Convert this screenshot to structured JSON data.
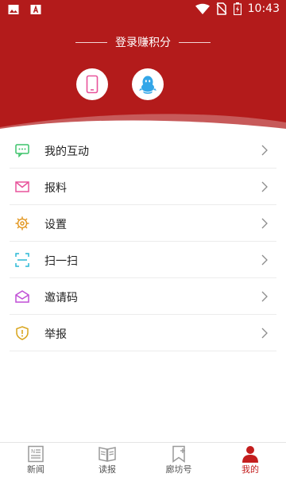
{
  "status_bar": {
    "time": "10:43",
    "icons": [
      "image-icon",
      "text-box-icon",
      "wifi-icon",
      "no-sim-icon",
      "battery-charging-icon"
    ]
  },
  "header": {
    "login_title": "登录赚积分",
    "login_options": [
      {
        "name": "phone-login",
        "icon": "phone-icon"
      },
      {
        "name": "qq-login",
        "icon": "qq-penguin-icon"
      }
    ],
    "colors": {
      "brand": "#b31b1b",
      "wave": "#c75a5a"
    }
  },
  "menu": {
    "items": [
      {
        "label": "我的互动",
        "icon": "chat-bubble-icon",
        "color": "#3cc36a"
      },
      {
        "label": "报料",
        "icon": "envelope-icon",
        "color": "#e8539b"
      },
      {
        "label": "设置",
        "icon": "gear-icon",
        "color": "#e39a27"
      },
      {
        "label": "扫一扫",
        "icon": "scan-icon",
        "color": "#2bb8d6"
      },
      {
        "label": "邀请码",
        "icon": "invite-envelope-icon",
        "color": "#c04fd6"
      },
      {
        "label": "举报",
        "icon": "shield-alert-icon",
        "color": "#d8a51d"
      }
    ]
  },
  "bottom_nav": {
    "items": [
      {
        "label": "新闻",
        "icon": "newspaper-icon",
        "active": false
      },
      {
        "label": "读报",
        "icon": "open-book-icon",
        "active": false
      },
      {
        "label": "廊坊号",
        "icon": "bookmark-plus-icon",
        "active": false
      },
      {
        "label": "我的",
        "icon": "user-icon",
        "active": true
      }
    ],
    "active_color": "#c31d1d"
  }
}
